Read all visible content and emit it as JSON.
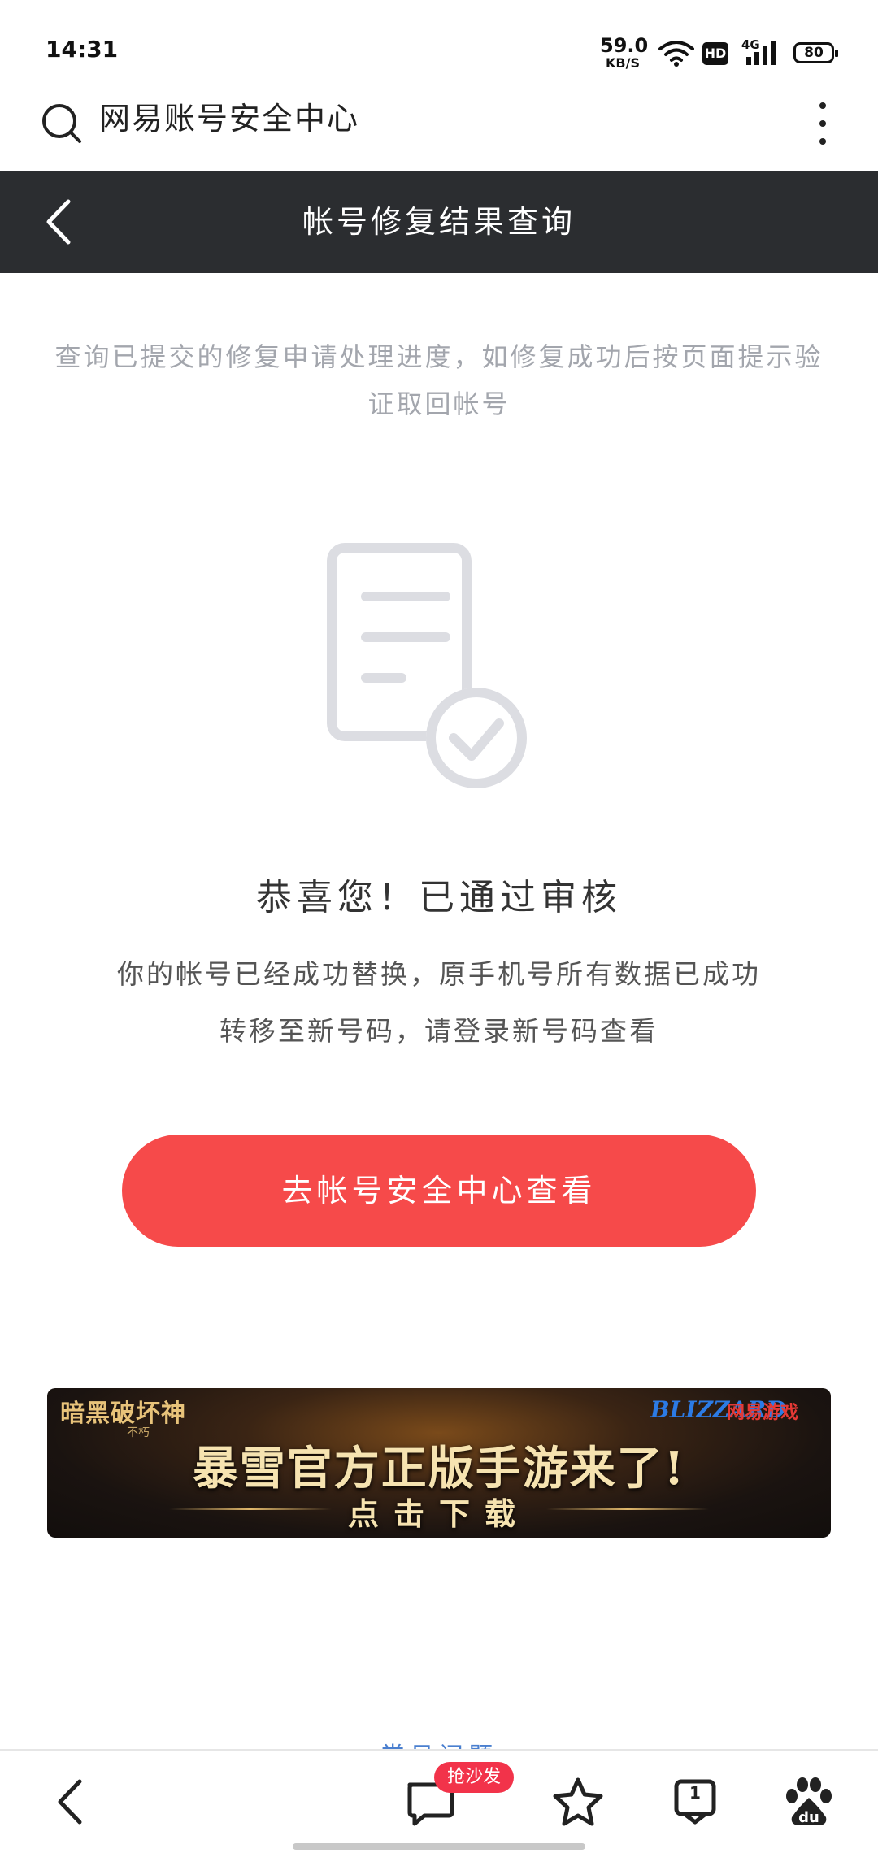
{
  "status_bar": {
    "time": "14:31",
    "speed_value": "59.0",
    "speed_unit": "KB/S",
    "hd": "HD",
    "network": "4G",
    "battery": "80"
  },
  "address_bar": {
    "title": "网易账号安全中心",
    "search_icon": "search-icon",
    "menu_icon": "more-vertical-icon"
  },
  "header": {
    "title": "帐号修复结果查询",
    "back_icon": "chevron-left-icon"
  },
  "intro": "查询已提交的修复申请处理进度，如修复成功后按页面提示验证取回帐号",
  "result": {
    "title": "恭喜您！已通过审核",
    "description": "你的帐号已经成功替换，原手机号所有数据已成功转移至新号码，请登录新号码查看",
    "button_label": "去帐号安全中心查看",
    "illustration_icon": "document-check-icon"
  },
  "banner": {
    "game_name": "暗黑破坏神",
    "game_sub": "不朽",
    "brand_blizzard": "BLIZZARD",
    "brand_netease": "网易游戏",
    "headline": "暴雪官方正版手游来了!",
    "cta": "点击下载"
  },
  "faq_link": "常见问题",
  "bottom_nav": {
    "badge": "抢沙发",
    "tabs_count": "1",
    "icons": [
      "back-icon",
      "comment-icon",
      "star-icon",
      "tabs-icon",
      "baidu-icon"
    ]
  },
  "colors": {
    "header_bg": "#2b2d30",
    "accent": "#f64a4a",
    "badge": "#f2334a"
  }
}
